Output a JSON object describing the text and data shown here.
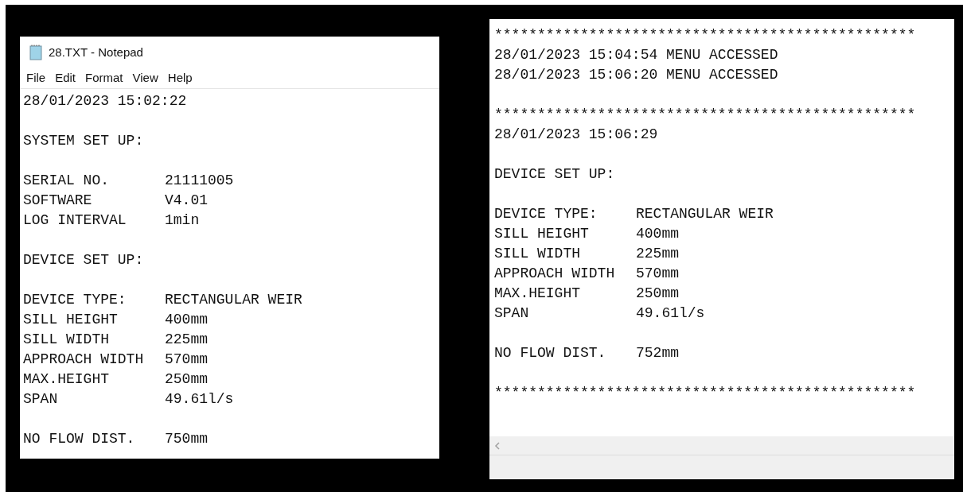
{
  "windows": [
    {
      "title": "28.TXT - Notepad",
      "menu": [
        "File",
        "Edit",
        "Format",
        "View",
        "Help"
      ],
      "blocks": [
        [
          {
            "label": "28/01/2023 15:02:22"
          }
        ],
        [
          {
            "label": "SYSTEM SET UP:"
          }
        ],
        [
          {
            "label": "SERIAL NO.",
            "value": "21111005"
          },
          {
            "label": "SOFTWARE",
            "value": "V4.01"
          },
          {
            "label": "LOG INTERVAL",
            "value": "1min"
          }
        ],
        [
          {
            "label": "DEVICE SET UP:"
          }
        ],
        [
          {
            "label": "DEVICE TYPE:",
            "value": "RECTANGULAR WEIR"
          },
          {
            "label": "SILL HEIGHT",
            "value": "400mm"
          },
          {
            "label": "SILL WIDTH",
            "value": "225mm"
          },
          {
            "label": "APPROACH WIDTH",
            "value": "570mm"
          },
          {
            "label": "MAX.HEIGHT",
            "value": "250mm"
          },
          {
            "label": "SPAN",
            "value": "49.61l/s"
          }
        ],
        [
          {
            "label": "NO FLOW DIST.",
            "value": "750mm"
          }
        ]
      ]
    },
    {
      "blocks": [
        [
          {
            "label": "*************************************************"
          },
          {
            "label": "28/01/2023 15:04:54 MENU ACCESSED"
          },
          {
            "label": "28/01/2023 15:06:20 MENU ACCESSED"
          }
        ],
        [
          {
            "label": "*************************************************"
          },
          {
            "label": "28/01/2023 15:06:29"
          }
        ],
        [
          {
            "label": "DEVICE SET UP:"
          }
        ],
        [
          {
            "label": "DEVICE TYPE:",
            "value": "RECTANGULAR WEIR"
          },
          {
            "label": "SILL HEIGHT",
            "value": "400mm"
          },
          {
            "label": "SILL WIDTH",
            "value": "225mm"
          },
          {
            "label": "APPROACH WIDTH",
            "value": "570mm"
          },
          {
            "label": "MAX.HEIGHT",
            "value": "250mm"
          },
          {
            "label": "SPAN",
            "value": "49.61l/s"
          }
        ],
        [
          {
            "label": "NO FLOW DIST.",
            "value": "752mm"
          }
        ],
        [
          {
            "label": "*************************************************"
          }
        ]
      ]
    }
  ]
}
